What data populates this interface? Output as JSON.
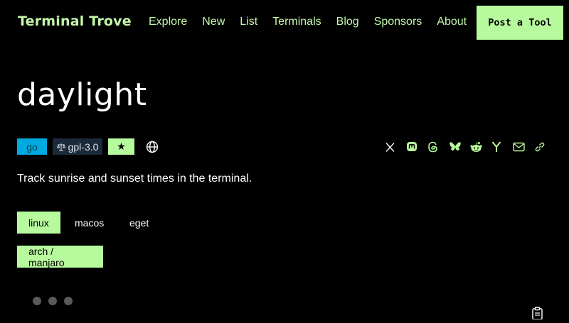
{
  "header": {
    "brand": "Terminal Trove",
    "nav": [
      "Explore",
      "New",
      "List",
      "Terminals",
      "Blog",
      "Sponsors",
      "About"
    ],
    "post_button": "Post a Tool"
  },
  "tool": {
    "name": "daylight",
    "language": "go",
    "license": "gpl-3.0",
    "star": "★",
    "description": "Track sunrise and sunset times in the terminal."
  },
  "platforms": {
    "row1": [
      "linux",
      "macos",
      "eget"
    ],
    "row2": [
      "arch / manjaro"
    ]
  },
  "share_icons": [
    "x-icon",
    "mastodon-icon",
    "threads-icon",
    "bluesky-icon",
    "reddit-icon",
    "hackernews-icon",
    "email-icon",
    "link-icon"
  ],
  "colors": {
    "accent": "#b7fa9d",
    "brand_text": "#c4f7a8",
    "language_badge": "#00a9e0",
    "license_badge": "#1b2a3b",
    "background": "#000000"
  }
}
